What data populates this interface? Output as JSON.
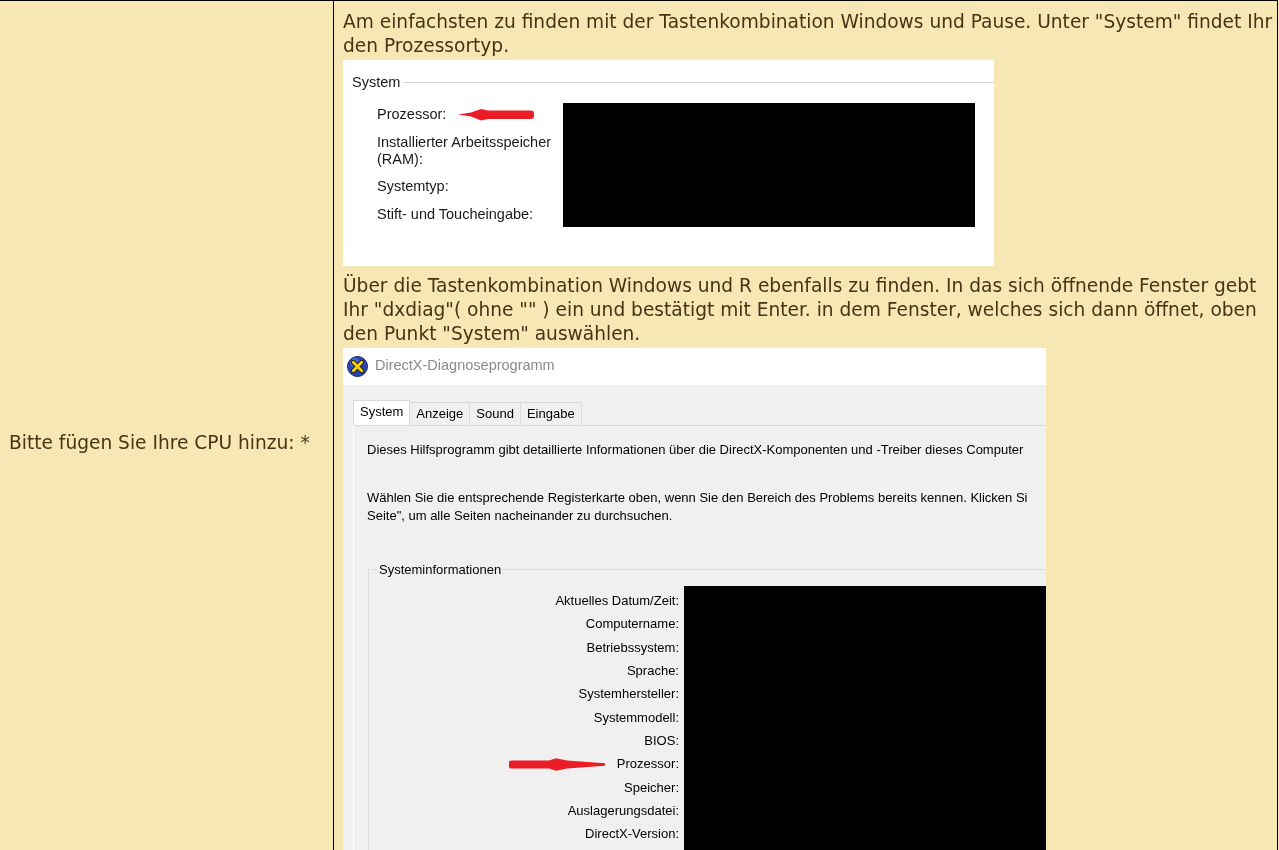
{
  "form_row": {
    "label": "Bitte fügen Sie Ihre CPU hinzu: *",
    "help": [
      {
        "kind": "paragraph",
        "text": "Am einfachsten zu finden mit der Tastenkombination Windows und Pause. Unter \"System\" findet Ihr den Prozessortyp."
      },
      {
        "kind": "system_screenshot",
        "group_title": "System",
        "fields": [
          {
            "label": "Prozessor:",
            "marked": true
          },
          {
            "label": "Installierter Arbeitsspeicher (RAM):",
            "marked": false
          },
          {
            "label": "Systemtyp:",
            "marked": false
          },
          {
            "label": "Stift- und Toucheingabe:",
            "marked": false
          }
        ]
      },
      {
        "kind": "paragraph",
        "text": "Über die Tastenkombination Windows und R ebenfalls zu finden. In das sich öffnende Fenster gebt Ihr \"dxdiag\"( ohne \"\" ) ein und bestätigt mit Enter. in dem Fenster, welches sich dann öffnet, oben den Punkt \"System\" auswählen."
      },
      {
        "kind": "dxdiag_screenshot",
        "title": "DirectX-Diagnoseprogramm",
        "tabs": [
          {
            "label": "System",
            "selected": true
          },
          {
            "label": "Anzeige",
            "selected": false
          },
          {
            "label": "Sound",
            "selected": false
          },
          {
            "label": "Eingabe",
            "selected": false
          }
        ],
        "intro": "Dieses Hilfsprogramm gibt detaillierte Informationen über die DirectX-Komponenten und -Treiber dieses Computer",
        "hint_lines": [
          "Wählen Sie die entsprechende Registerkarte oben, wenn Sie den Bereich des Problems bereits kennen. Klicken Si",
          "Seite\", um alle Seiten nacheinander zu durchsuchen."
        ],
        "group_title": "Systeminformationen",
        "fields": [
          {
            "label": "Aktuelles Datum/Zeit:",
            "marked": false
          },
          {
            "label": "Computername:",
            "marked": false
          },
          {
            "label": "Betriebssystem:",
            "marked": false
          },
          {
            "label": "Sprache:",
            "marked": false
          },
          {
            "label": "Systemhersteller:",
            "marked": false
          },
          {
            "label": "Systemmodell:",
            "marked": false
          },
          {
            "label": "BIOS:",
            "marked": false
          },
          {
            "label": "Prozessor:",
            "marked": true
          },
          {
            "label": "Speicher:",
            "marked": false
          },
          {
            "label": "Auslagerungsdatei:",
            "marked": false
          },
          {
            "label": "DirectX-Version:",
            "marked": false
          }
        ]
      }
    ]
  }
}
